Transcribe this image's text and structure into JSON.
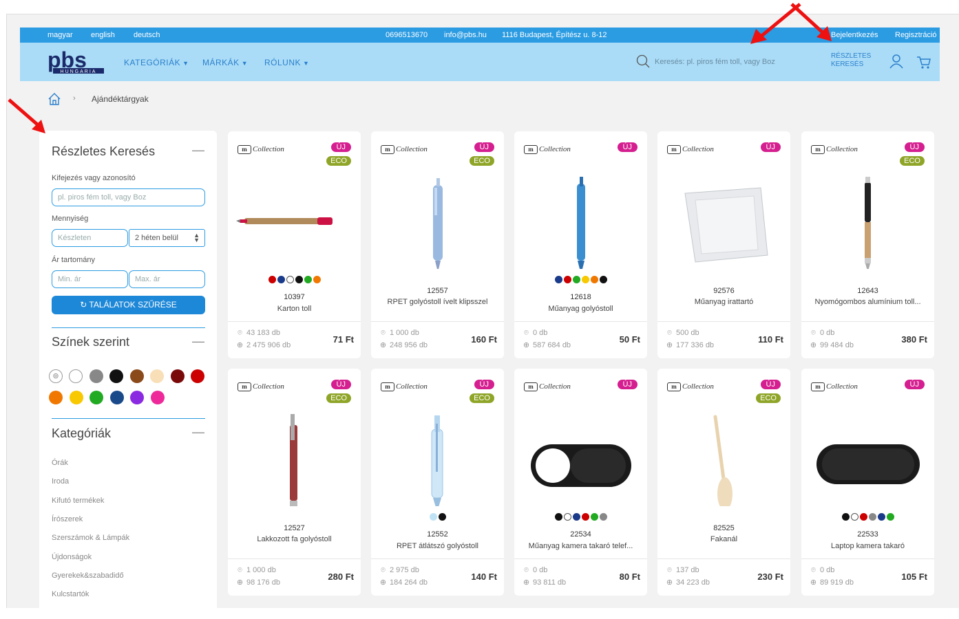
{
  "topbar": {
    "lang_hu": "magyar",
    "lang_en": "english",
    "lang_de": "deutsch",
    "phone": "0696513670",
    "email": "info@pbs.hu",
    "address": "1116 Budapest, Építész u. 8-12",
    "login": "Bejelentkezés",
    "register": "Regisztráció"
  },
  "nav": {
    "logo_text": "pbs",
    "logo_sub": "HUNGARIA",
    "categories": "KATEGÓRIÁK",
    "brands": "MÁRKÁK",
    "about": "RÓLUNK",
    "search_placeholder": "Keresés: pl. piros fém toll, vagy Boz",
    "detailed_search_line1": "RÉSZLETES",
    "detailed_search_line2": "KERESÉS"
  },
  "breadcrumb": {
    "separator": "›",
    "current": "Ajándéktárgyak"
  },
  "sidebar": {
    "detailed_title": "Részletes Keresés",
    "collapse": "—",
    "keyword_label": "Kifejezés vagy azonosító",
    "keyword_placeholder": "pl. piros fém toll, vagy Boz",
    "quantity_label": "Mennyiség",
    "quantity_placeholder": "Készleten",
    "quantity_select": "2 héten belül",
    "price_label": "Ár tartomány",
    "min_price_placeholder": "Min. ár",
    "max_price_placeholder": "Max. ár",
    "filter_button": "TALÁLATOK SZŰRÉSE",
    "colors_title": "Színek szerint",
    "colors": [
      "#ffffff",
      "#888888",
      "#111111",
      "#8a4a1a",
      "#f8dfb8",
      "#7a0a0a",
      "#cc0000",
      "#f07800",
      "#f8c800",
      "#22aa22",
      "#1a4a8a",
      "#8a2be2",
      "#ee2a9a"
    ],
    "categories_title": "Kategóriák",
    "categories": [
      "Órák",
      "Iroda",
      "Kifutó termékek",
      "Írószerek",
      "Szerszámok & Lámpák",
      "Újdonságok",
      "Gyerekek&szabadidő",
      "Kulcstartók"
    ]
  },
  "products": [
    {
      "brand": "Collection",
      "new": "ÚJ",
      "eco": "ECO",
      "code": "10397",
      "name": "Karton toll",
      "colors": [
        "#cc0000",
        "#1a3a8a",
        "#ffffff",
        "#111111",
        "#22aa22",
        "#f07800"
      ],
      "stock_local": "43 183 db",
      "stock_global": "2 475 906 db",
      "price": "71 Ft",
      "img": "pen-red"
    },
    {
      "brand": "Collection",
      "new": "ÚJ",
      "eco": "ECO",
      "code": "12557",
      "name": "RPET golyóstoll ívelt klipsszel",
      "colors": [],
      "stock_local": "1 000 db",
      "stock_global": "248 956 db",
      "price": "160 Ft",
      "img": "pen-lightblue"
    },
    {
      "brand": "Collection",
      "new": "ÚJ",
      "eco": "",
      "code": "12618",
      "name": "Műanyag golyóstoll",
      "colors": [
        "#1a3a8a",
        "#cc0000",
        "#22aa22",
        "#f8c800",
        "#f07800",
        "#111111"
      ],
      "stock_local": "0 db",
      "stock_global": "587 684 db",
      "price": "50 Ft",
      "img": "pen-blue"
    },
    {
      "brand": "Collection",
      "new": "ÚJ",
      "eco": "",
      "code": "92576",
      "name": "Műanyag irattartó",
      "colors": [],
      "stock_local": "500 db",
      "stock_global": "177 336 db",
      "price": "110 Ft",
      "img": "folder"
    },
    {
      "brand": "Collection",
      "new": "ÚJ",
      "eco": "ECO",
      "code": "12643",
      "name": "Nyomógombos alumínium toll...",
      "colors": [],
      "stock_local": "0 db",
      "stock_global": "99 484 db",
      "price": "380 Ft",
      "img": "pen-black"
    },
    {
      "brand": "Collection",
      "new": "ÚJ",
      "eco": "ECO",
      "code": "12527",
      "name": "Lakkozott fa golyóstoll",
      "colors": [],
      "stock_local": "1 000 db",
      "stock_global": "98 176 db",
      "price": "280 Ft",
      "img": "pen-wood"
    },
    {
      "brand": "Collection",
      "new": "ÚJ",
      "eco": "ECO",
      "code": "12552",
      "name": "RPET átlátszó golyóstoll",
      "colors": [
        "#bfe3f5",
        "#111111"
      ],
      "stock_local": "2 975 db",
      "stock_global": "184 264 db",
      "price": "140 Ft",
      "img": "pen-clear"
    },
    {
      "brand": "Collection",
      "new": "ÚJ",
      "eco": "",
      "code": "22534",
      "name": "Műanyag kamera takaró telef...",
      "colors": [
        "#111111",
        "#ffffff",
        "#1a3a8a",
        "#cc0000",
        "#22aa22",
        "#888888"
      ],
      "stock_local": "0 db",
      "stock_global": "93 811 db",
      "price": "80 Ft",
      "img": "camcover-open"
    },
    {
      "brand": "Collection",
      "new": "ÚJ",
      "eco": "ECO",
      "code": "82525",
      "name": "Fakanál",
      "colors": [],
      "stock_local": "137 db",
      "stock_global": "34 223 db",
      "price": "230 Ft",
      "img": "spoon"
    },
    {
      "brand": "Collection",
      "new": "ÚJ",
      "eco": "",
      "code": "22533",
      "name": "Laptop kamera takaró",
      "colors": [
        "#111111",
        "#ffffff",
        "#cc0000",
        "#888888",
        "#1a3a8a",
        "#22aa22"
      ],
      "stock_local": "0 db",
      "stock_global": "89 919 db",
      "price": "105 Ft",
      "img": "camcover-closed"
    }
  ],
  "accent_colors": {
    "topbar": "#2b9be2",
    "navbar": "#aadcf7",
    "badge_new": "#d51e8f",
    "badge_eco": "#8ea528",
    "annotation_arrow": "#ee1111"
  }
}
